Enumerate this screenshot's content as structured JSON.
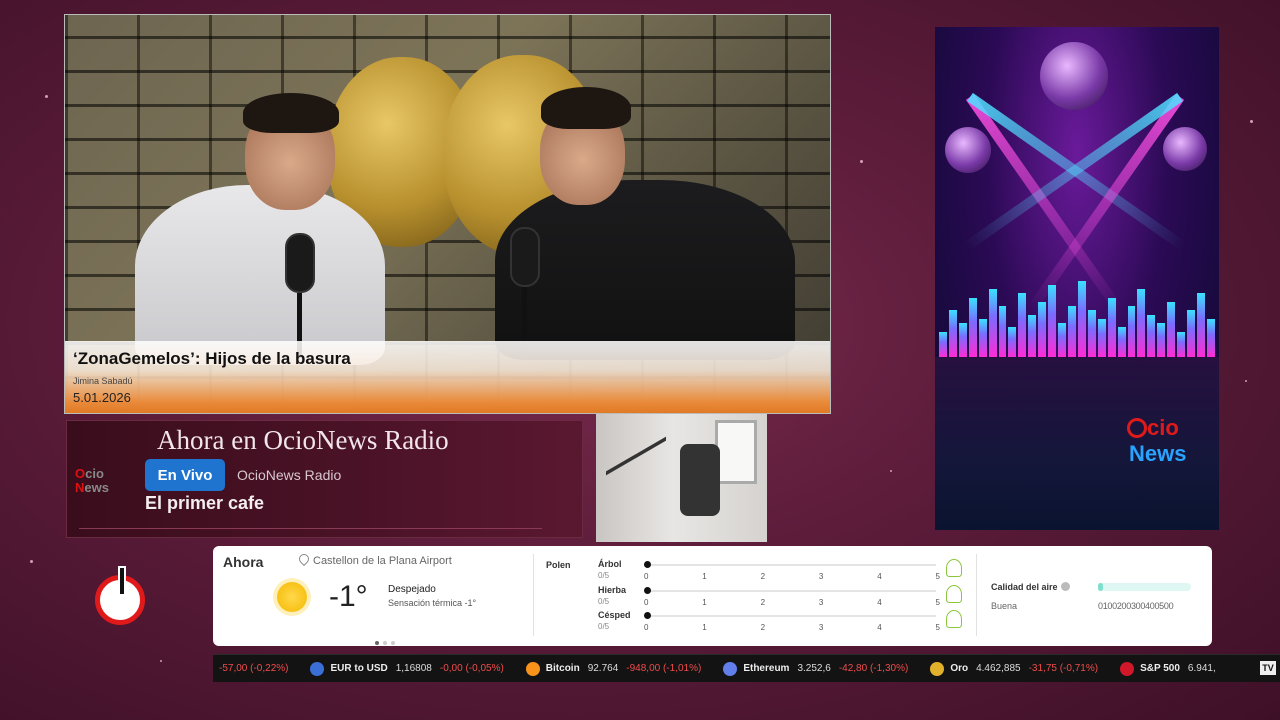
{
  "video": {
    "title": "‘ZonaGemelos’: Hijos de la basura",
    "author": "Jimina Sabadú",
    "date": "5.01.2026"
  },
  "now_playing": {
    "heading": "Ahora en OcioNews Radio",
    "live_label": "En Vivo",
    "station": "OcioNews Radio",
    "show": "El primer cafe"
  },
  "promo": {
    "brand_ocio": "cio",
    "brand_news": "News"
  },
  "weather": {
    "now_label": "Ahora",
    "location": "Castellon de la Plana Airport",
    "temperature": "-1°",
    "condition": "Despejado",
    "feels_like": "Sensación térmica -1°",
    "pollen_label": "Polen",
    "pollen": [
      {
        "name": "Árbol",
        "value": "0/5"
      },
      {
        "name": "Hierba",
        "value": "0/5"
      },
      {
        "name": "Césped",
        "value": "0/5"
      }
    ],
    "pollen_scale": [
      "0",
      "1",
      "2",
      "3",
      "4",
      "5"
    ],
    "air_quality_label": "Calidad del aire",
    "air_quality_status": "Buena",
    "air_quality_level": 0.05,
    "air_quality_scale": "0100200300400500"
  },
  "ticker": [
    {
      "name": "",
      "value": "",
      "change": "-57,00 (-0,22%)",
      "icon": "none",
      "color": ""
    },
    {
      "name": "EUR to USD",
      "value": "1,16808",
      "change": "-0,00 (-0,05%)",
      "icon": "currency-icon",
      "color": "#3b6fd8"
    },
    {
      "name": "Bitcoin",
      "value": "92.764",
      "change": "-948,00 (-1,01%)",
      "icon": "bitcoin-icon",
      "color": "#f7931a"
    },
    {
      "name": "Ethereum",
      "value": "3.252,6",
      "change": "-42,80 (-1,30%)",
      "icon": "ethereum-icon",
      "color": "#627eea"
    },
    {
      "name": "Oro",
      "value": "4.462,885",
      "change": "-31,75 (-0,71%)",
      "icon": "gold-icon",
      "color": "#e1b12c"
    },
    {
      "name": "S&P 500",
      "value": "6.941,",
      "change": "",
      "icon": "sp500-icon",
      "color": "#d1182b"
    }
  ],
  "colors": {
    "accent_red": "#e01a1a",
    "accent_blue": "#1f74cf",
    "negative": "#f04b4b"
  }
}
